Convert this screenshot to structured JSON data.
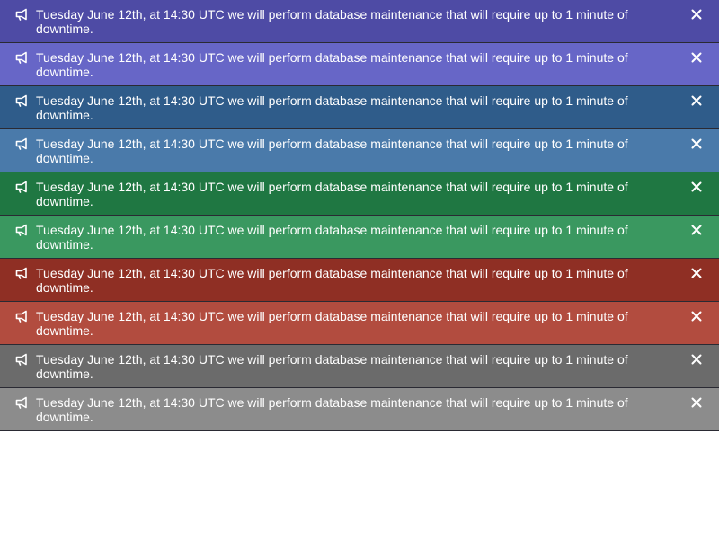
{
  "banners": [
    {
      "message": "Tuesday June 12th, at 14:30 UTC we will perform database maintenance that will require up to 1 minute of downtime.",
      "color": "#4e4ba5",
      "icon": "megaphone-icon",
      "close_icon": "close-icon"
    },
    {
      "message": "Tuesday June 12th, at 14:30 UTC we will perform database maintenance that will require up to 1 minute of downtime.",
      "color": "#6766c7",
      "icon": "megaphone-icon",
      "close_icon": "close-icon"
    },
    {
      "message": "Tuesday June 12th, at 14:30 UTC we will perform database maintenance that will require up to 1 minute of downtime.",
      "color": "#2f5c8a",
      "icon": "megaphone-icon",
      "close_icon": "close-icon"
    },
    {
      "message": "Tuesday June 12th, at 14:30 UTC we will perform database maintenance that will require up to 1 minute of downtime.",
      "color": "#4a7aaa",
      "icon": "megaphone-icon",
      "close_icon": "close-icon"
    },
    {
      "message": "Tuesday June 12th, at 14:30 UTC we will perform database maintenance that will require up to 1 minute of downtime.",
      "color": "#1f7742",
      "icon": "megaphone-icon",
      "close_icon": "close-icon"
    },
    {
      "message": "Tuesday June 12th, at 14:30 UTC we will perform database maintenance that will require up to 1 minute of downtime.",
      "color": "#3a9860",
      "icon": "megaphone-icon",
      "close_icon": "close-icon"
    },
    {
      "message": "Tuesday June 12th, at 14:30 UTC we will perform database maintenance that will require up to 1 minute of downtime.",
      "color": "#8f2f24",
      "icon": "megaphone-icon",
      "close_icon": "close-icon"
    },
    {
      "message": "Tuesday June 12th, at 14:30 UTC we will perform database maintenance that will require up to 1 minute of downtime.",
      "color": "#b24c3f",
      "icon": "megaphone-icon",
      "close_icon": "close-icon"
    },
    {
      "message": "Tuesday June 12th, at 14:30 UTC we will perform database maintenance that will require up to 1 minute of downtime.",
      "color": "#6b6b6b",
      "icon": "megaphone-icon",
      "close_icon": "close-icon"
    },
    {
      "message": "Tuesday June 12th, at 14:30 UTC we will perform database maintenance that will require up to 1 minute of downtime.",
      "color": "#8c8c8c",
      "icon": "megaphone-icon",
      "close_icon": "close-icon"
    }
  ]
}
